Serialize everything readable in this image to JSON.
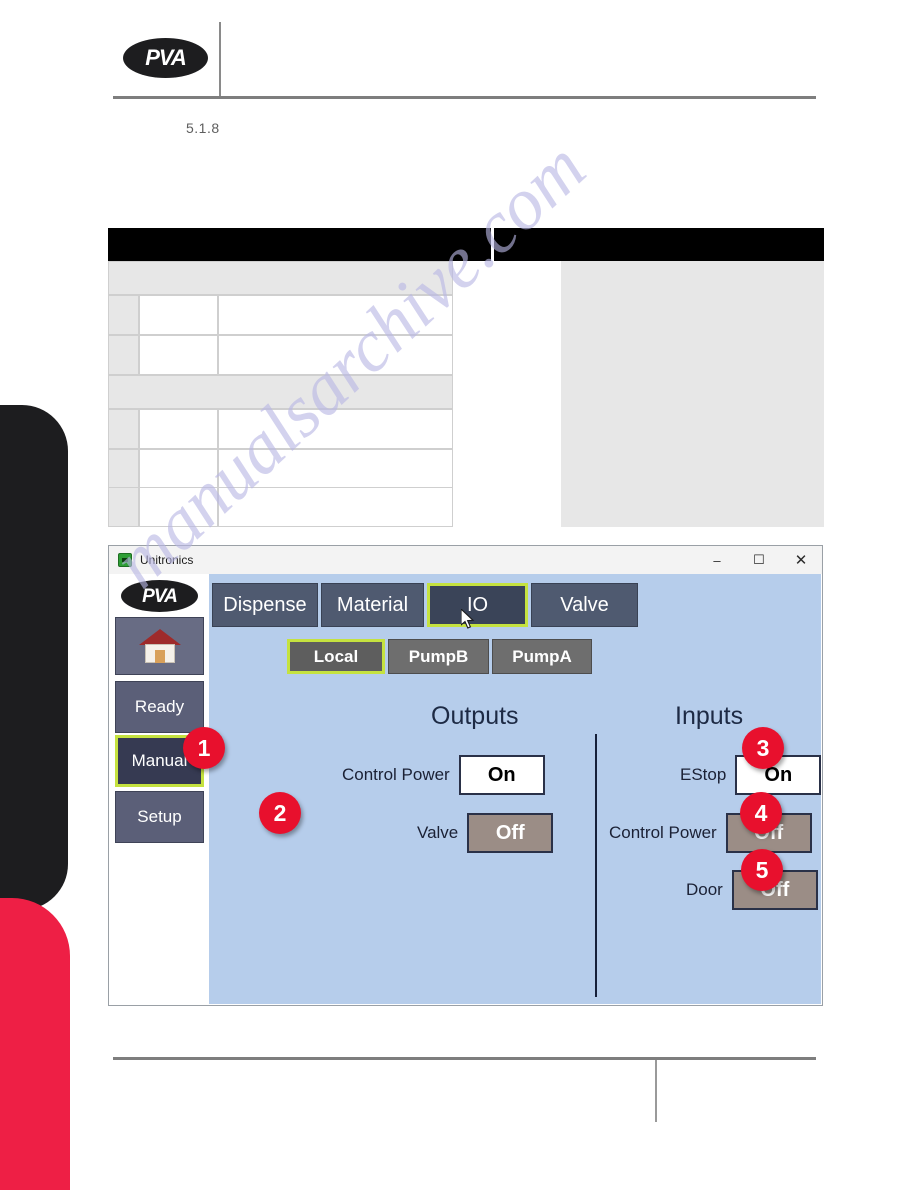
{
  "document": {
    "brand": "PVA",
    "section_number": "5.1.8",
    "watermark": "manualsarchive.com"
  },
  "table": {
    "bands": 2,
    "rows": 5
  },
  "app": {
    "title": "Unitronics",
    "icon": "unitronics-icon",
    "window_controls": {
      "minimize": "–",
      "maximize": "☐",
      "close": "✕"
    },
    "logo": "PVA",
    "sidebar": {
      "home_icon": "home-icon",
      "items": [
        {
          "label": "Ready",
          "selected": false
        },
        {
          "label": "Manual",
          "selected": true
        },
        {
          "label": "Setup",
          "selected": false
        }
      ]
    },
    "tabs": [
      {
        "label": "Dispense",
        "selected": false
      },
      {
        "label": "Material",
        "selected": false
      },
      {
        "label": "IO",
        "selected": true
      },
      {
        "label": "Valve",
        "selected": false
      }
    ],
    "subtabs": [
      {
        "label": "Local",
        "selected": true
      },
      {
        "label": "PumpB",
        "selected": false
      },
      {
        "label": "PumpA",
        "selected": false
      }
    ],
    "outputs": {
      "heading": "Outputs",
      "rows": [
        {
          "label": "Control Power",
          "value": "On",
          "state": "on"
        },
        {
          "label": "Valve",
          "value": "Off",
          "state": "off"
        }
      ]
    },
    "inputs": {
      "heading": "Inputs",
      "rows": [
        {
          "label": "EStop",
          "value": "On",
          "state": "on"
        },
        {
          "label": "Control Power",
          "value": "Off",
          "state": "off"
        },
        {
          "label": "Door",
          "value": "Off",
          "state": "off"
        }
      ]
    },
    "callouts": [
      "1",
      "2",
      "3",
      "4",
      "5"
    ],
    "colors": {
      "screen_background": "#b6cdeb",
      "button": "#5b5f78",
      "selected_border": "#c5e23f",
      "callout": "#e8102d",
      "value_off": "#9b8d86",
      "value_on": "#ffffff",
      "accent_red": "#ee1f45",
      "edge_black": "#1d1d1f"
    }
  }
}
